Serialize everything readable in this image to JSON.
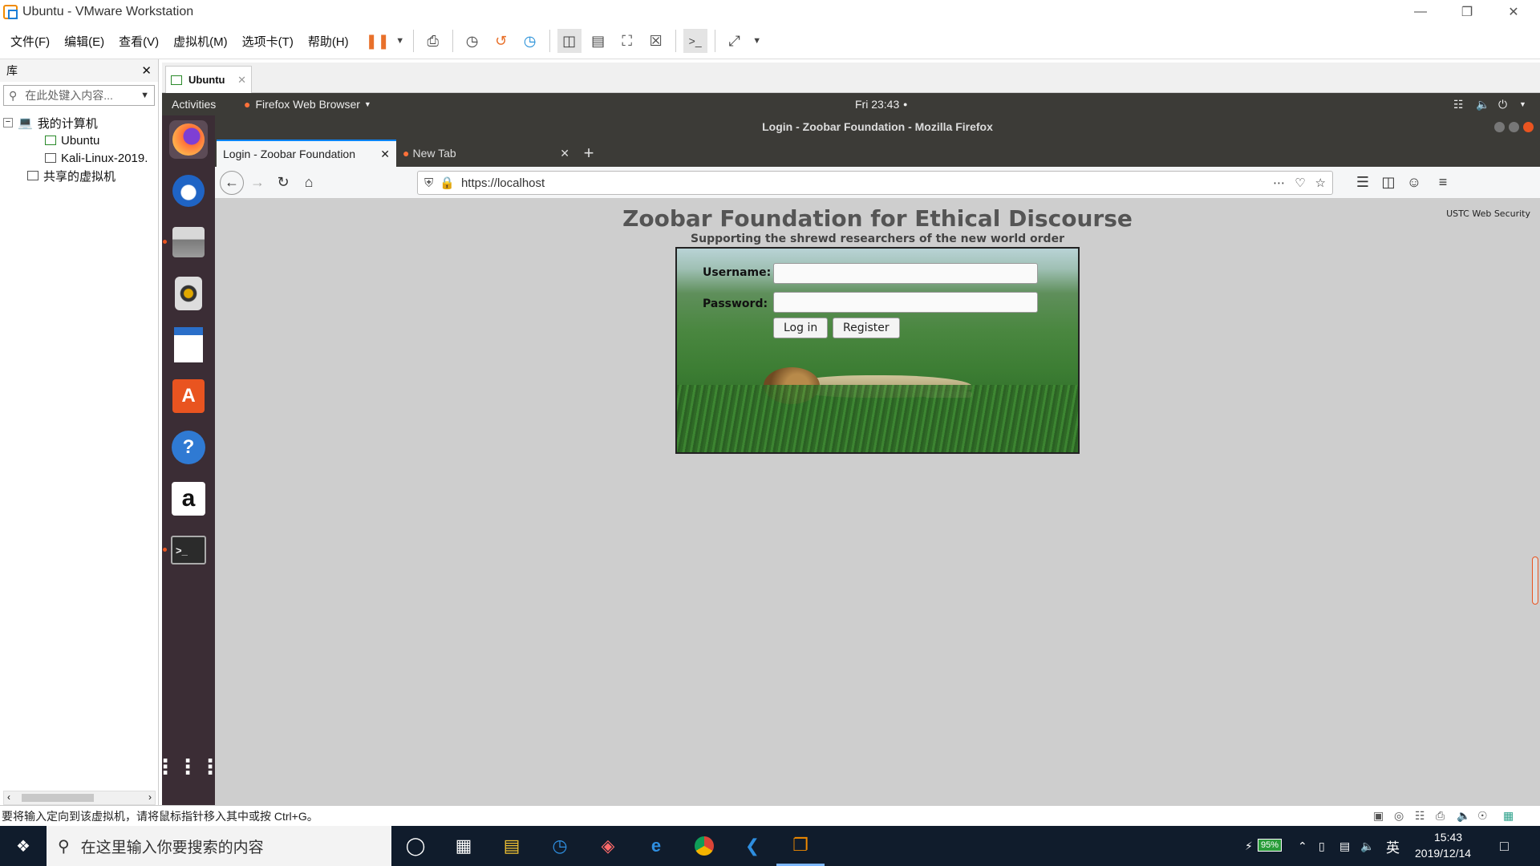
{
  "vmware": {
    "window_title": "Ubuntu - VMware Workstation",
    "menu": [
      "文件(F)",
      "编辑(E)",
      "查看(V)",
      "虚拟机(M)",
      "选项卡(T)",
      "帮助(H)"
    ],
    "library": {
      "title": "库",
      "search_placeholder": "在此处键入内容...",
      "tree": {
        "my_computer": "我的计算机",
        "vm1": "Ubuntu",
        "vm2": "Kali-Linux-2019.",
        "shared": "共享的虚拟机"
      }
    },
    "vm_tab": "Ubuntu",
    "status_text": "要将输入定向到该虚拟机，请将鼠标指针移入其中或按 Ctrl+G。"
  },
  "ubuntu": {
    "activities": "Activities",
    "app_menu": "Firefox Web Browser",
    "clock": "Fri 23:43"
  },
  "firefox": {
    "window_title": "Login - Zoobar Foundation - Mozilla Firefox",
    "tabs": [
      {
        "label": "Login - Zoobar Foundation"
      },
      {
        "label": "New Tab"
      }
    ],
    "url": "https://localhost"
  },
  "page": {
    "title": "Zoobar Foundation for Ethical Discourse",
    "subtitle": "Supporting the shrewd researchers of the new world order",
    "corner": "USTC Web Security",
    "username_label": "Username:",
    "password_label": "Password:",
    "login_button": "Log in",
    "register_button": "Register"
  },
  "taskbar": {
    "search_placeholder": "在这里输入你要搜索的内容",
    "battery": "95%",
    "ime": "英",
    "time": "15:43",
    "date": "2019/12/14"
  }
}
